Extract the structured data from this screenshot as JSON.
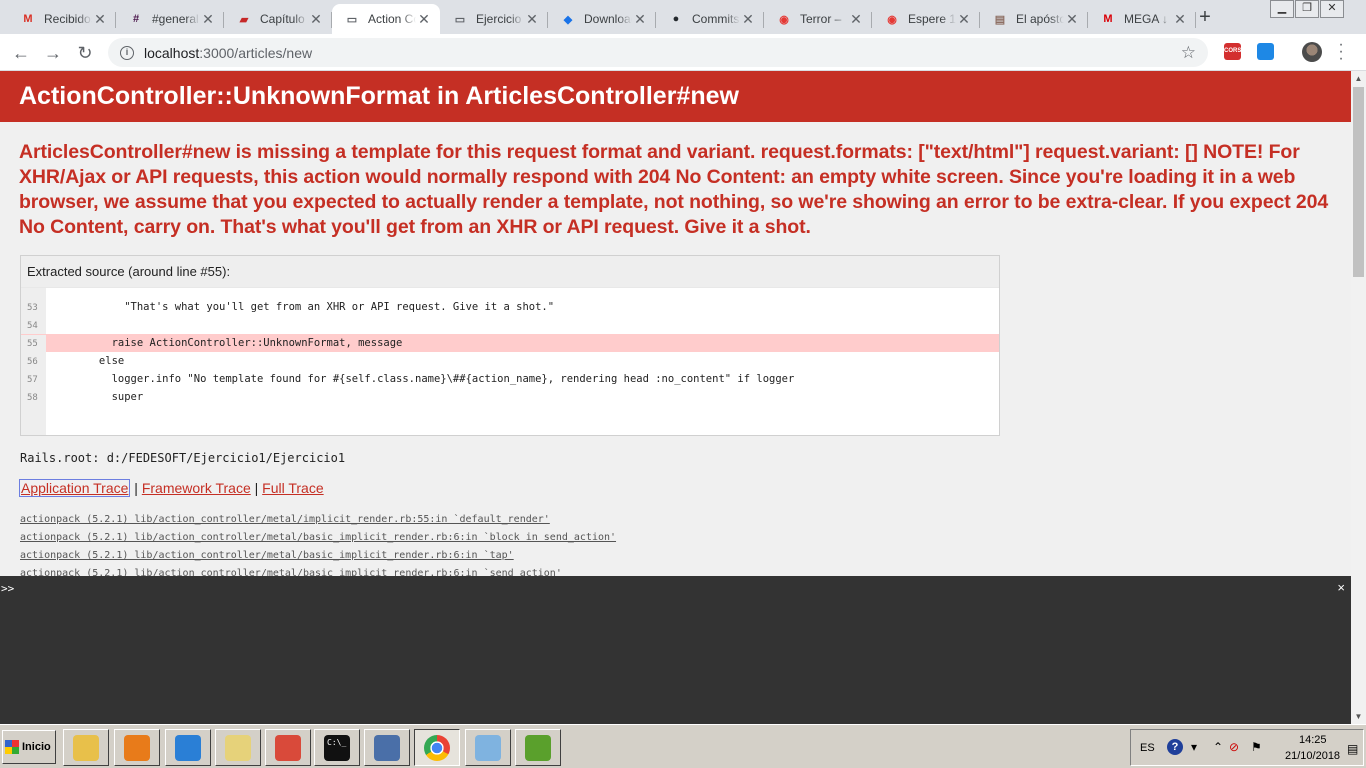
{
  "browser": {
    "tabs": [
      {
        "title": "Recibidos",
        "icon": "gmail-icon",
        "color": "#d93025",
        "glyph": "M"
      },
      {
        "title": "#general",
        "icon": "slack-icon",
        "color": "#4a154b",
        "glyph": "#"
      },
      {
        "title": "Capítulo",
        "icon": "book-icon",
        "color": "#c62828",
        "glyph": "▰"
      },
      {
        "title": "Action Controller",
        "icon": "page-icon",
        "color": "#5f6368",
        "glyph": "▭",
        "active": true
      },
      {
        "title": "Ejercicio",
        "icon": "page-icon",
        "color": "#5f6368",
        "glyph": "▭"
      },
      {
        "title": "Download",
        "icon": "drive-icon",
        "color": "#1a73e8",
        "glyph": "◆"
      },
      {
        "title": "Commits",
        "icon": "github-icon",
        "color": "#24292e",
        "glyph": "●"
      },
      {
        "title": "Terror –",
        "icon": "youtube-icon",
        "color": "#e53935",
        "glyph": "◉"
      },
      {
        "title": "Espere 1",
        "icon": "youtube-icon",
        "color": "#e53935",
        "glyph": "◉"
      },
      {
        "title": "El apóstol",
        "icon": "clipboard-icon",
        "color": "#8d6e63",
        "glyph": "▤"
      },
      {
        "title": "MEGA ↓",
        "icon": "mega-icon",
        "color": "#d90007",
        "glyph": "M"
      }
    ],
    "new_tab": "+",
    "address": {
      "host": "localhost",
      "path": ":3000/articles/new"
    },
    "ext_cors": "CORS"
  },
  "page": {
    "header": "ActionController::UnknownFormat in ArticlesController#new",
    "message": "ArticlesController#new is missing a template for this request format and variant. request.formats: [\"text/html\"] request.variant: [] NOTE! For XHR/Ajax or API requests, this action would normally respond with 204 No Content: an empty white screen. Since you're loading it in a web browser, we assume that you expected to actually render a template, not nothing, so we're showing an error to be extra-clear. If you expect 204 No Content, carry on. That's what you'll get from an XHR or API request. Give it a shot.",
    "source_title": "Extracted source (around line #55):",
    "source_lines": [
      {
        "n": "53",
        "text": "          \"That's what you'll get from an XHR or API request. Give it a shot.\""
      },
      {
        "n": "54",
        "text": ""
      },
      {
        "n": "55",
        "text": "        raise ActionController::UnknownFormat, message",
        "highlight": true
      },
      {
        "n": "56",
        "text": "      else"
      },
      {
        "n": "57",
        "text": "        logger.info \"No template found for #{self.class.name}\\##{action_name}, rendering head :no_content\" if logger"
      },
      {
        "n": "58",
        "text": "        super"
      }
    ],
    "rails_root": "Rails.root: d:/FEDESOFT/Ejercicio1/Ejercicio1",
    "trace_links": {
      "application": "Application Trace",
      "framework": "Framework Trace",
      "full": "Full Trace",
      "sep": "|"
    },
    "trace": [
      "actionpack (5.2.1) lib/action_controller/metal/implicit_render.rb:55:in `default_render'",
      "actionpack (5.2.1) lib/action_controller/metal/basic_implicit_render.rb:6:in `block in send_action'",
      "actionpack (5.2.1) lib/action_controller/metal/basic_implicit_render.rb:6:in `tap'",
      "actionpack (5.2.1) lib/action_controller/metal/basic_implicit_render.rb:6:in `send_action'"
    ]
  },
  "console": {
    "prompt": ">>",
    "close": "×"
  },
  "taskbar": {
    "start": "Inicio",
    "apps": [
      {
        "icon": "file-explorer-icon",
        "color": "#e8c04a"
      },
      {
        "icon": "media-player-icon",
        "color": "#e87b1a"
      },
      {
        "icon": "internet-explorer-icon",
        "color": "#2a7fd6"
      },
      {
        "icon": "folder-icon",
        "color": "#e6d27a"
      },
      {
        "icon": "app-icon",
        "color": "#d94a3a"
      },
      {
        "icon": "cmd-icon",
        "color": "#111111",
        "glyph": "C:\\_"
      },
      {
        "icon": "network-icon",
        "color": "#4a6fa8"
      },
      {
        "icon": "chrome-icon",
        "color": "#1a73e8",
        "active": true
      },
      {
        "icon": "paint-icon",
        "color": "#7fb3e0"
      },
      {
        "icon": "notepad-icon",
        "color": "#5aa02c"
      }
    ],
    "lang": "ES",
    "time": "14:25",
    "date": "21/10/2018"
  }
}
